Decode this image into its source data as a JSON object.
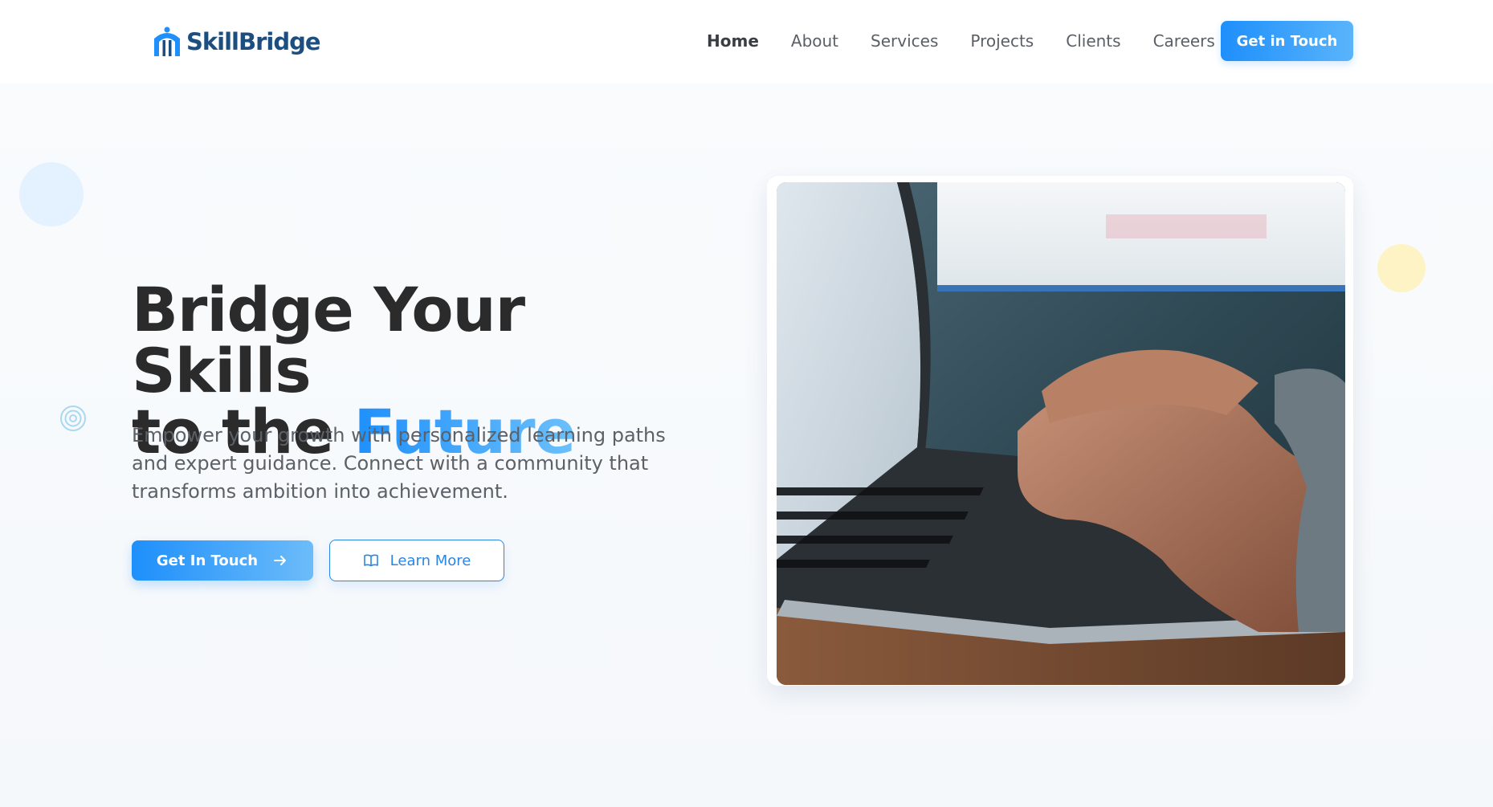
{
  "brand": {
    "name": "SkillBridge",
    "primary_color": "#1e8ffb",
    "dark_color": "#1c4e80",
    "logo_icon": "bridge-logo-icon"
  },
  "nav": {
    "links": [
      {
        "label": "Home",
        "active": true
      },
      {
        "label": "About",
        "active": false
      },
      {
        "label": "Services",
        "active": false
      },
      {
        "label": "Projects",
        "active": false
      },
      {
        "label": "Clients",
        "active": false
      },
      {
        "label": "Careers",
        "active": false
      }
    ],
    "cta_label": "Get in Touch"
  },
  "hero": {
    "title_line1": "Bridge Your Skills",
    "title_line2_prefix": "to the ",
    "title_accent": "Future",
    "subtitle": "Empower your growth with personalized learning paths and expert guidance. Connect with a community that transforms ambition into achievement.",
    "primary_button": {
      "label": "Get In Touch",
      "icon": "arrow-right-icon"
    },
    "secondary_button": {
      "label": "Learn More",
      "icon": "book-open-icon"
    }
  }
}
